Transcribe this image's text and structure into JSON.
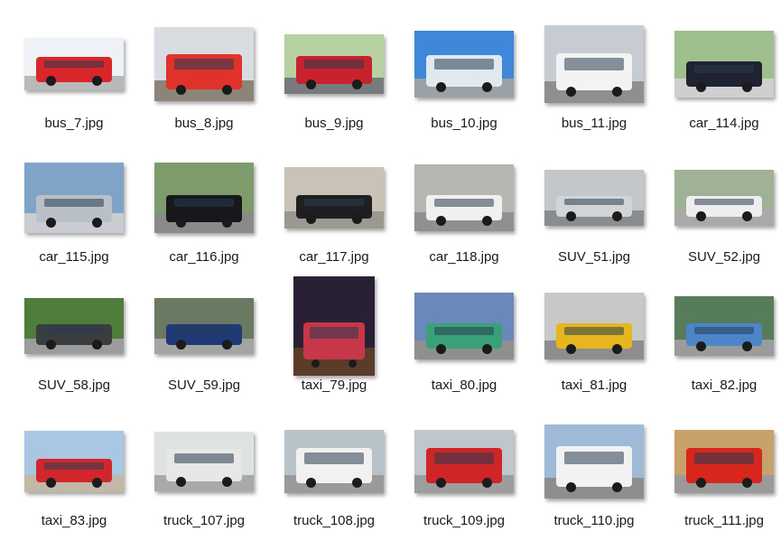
{
  "files": [
    {
      "name": "bus_7.jpg",
      "icon": "bus-icon",
      "sky": "#eef2f6",
      "ground": "#b9b9b9",
      "body": "#d9262b"
    },
    {
      "name": "bus_8.jpg",
      "icon": "bus-icon",
      "sky": "#d9dde2",
      "ground": "#8a8577",
      "body": "#e0312b"
    },
    {
      "name": "bus_9.jpg",
      "icon": "bus-icon",
      "sky": "#b8d1a2",
      "ground": "#777b7e",
      "body": "#c8232d"
    },
    {
      "name": "bus_10.jpg",
      "icon": "bus-icon",
      "sky": "#3f87d8",
      "ground": "#9aa2a8",
      "body": "#dfe9ef"
    },
    {
      "name": "bus_11.jpg",
      "icon": "bus-icon",
      "sky": "#c6ccd2",
      "ground": "#8e8f90",
      "body": "#f3f3f3"
    },
    {
      "name": "car_114.jpg",
      "icon": "car-icon",
      "sky": "#9fbf8f",
      "ground": "#cfcfcf",
      "body": "#1f2230"
    },
    {
      "name": "car_115.jpg",
      "icon": "car-icon",
      "sky": "#7fa4c8",
      "ground": "#c9ccd0",
      "body": "#b9c0c7"
    },
    {
      "name": "car_116.jpg",
      "icon": "car-icon",
      "sky": "#7e9b6b",
      "ground": "#8a8a8a",
      "body": "#16181c"
    },
    {
      "name": "car_117.jpg",
      "icon": "car-icon",
      "sky": "#c9c2b6",
      "ground": "#9a9890",
      "body": "#1f1f22"
    },
    {
      "name": "car_118.jpg",
      "icon": "car-icon",
      "sky": "#b4b7b2",
      "ground": "#909090",
      "body": "#f0f0f0"
    },
    {
      "name": "SUV_51.jpg",
      "icon": "suv-icon",
      "sky": "#c3c7ca",
      "ground": "#8b8c8e",
      "body": "#d2d5d8"
    },
    {
      "name": "SUV_52.jpg",
      "icon": "suv-icon",
      "sky": "#9fb196",
      "ground": "#a9a9a9",
      "body": "#eeeeee"
    },
    {
      "name": "SUV_58.jpg",
      "icon": "suv-icon",
      "sky": "#4f7d3c",
      "ground": "#9c9c9c",
      "body": "#3a3d40"
    },
    {
      "name": "SUV_59.jpg",
      "icon": "suv-icon",
      "sky": "#6a7a62",
      "ground": "#a4a4a4",
      "body": "#1f3a77"
    },
    {
      "name": "taxi_79.jpg",
      "icon": "taxi-icon",
      "sky": "#2a2036",
      "ground": "#5a3c28",
      "body": "#c8364a"
    },
    {
      "name": "taxi_80.jpg",
      "icon": "taxi-icon",
      "sky": "#6a88b9",
      "ground": "#8f8f8f",
      "body": "#3aa07a"
    },
    {
      "name": "taxi_81.jpg",
      "icon": "taxi-icon",
      "sky": "#c7c9c6",
      "ground": "#8d8d8d",
      "body": "#e7b51e"
    },
    {
      "name": "taxi_82.jpg",
      "icon": "taxi-icon",
      "sky": "#567c5a",
      "ground": "#9b9b9b",
      "body": "#4c86c9"
    },
    {
      "name": "taxi_83.jpg",
      "icon": "taxi-icon",
      "sky": "#a9c6e3",
      "ground": "#c2b8a8",
      "body": "#d2262d"
    },
    {
      "name": "truck_107.jpg",
      "icon": "truck-icon",
      "sky": "#dfe2e3",
      "ground": "#a9a9a9",
      "body": "#e7e7e7"
    },
    {
      "name": "truck_108.jpg",
      "icon": "truck-icon",
      "sky": "#b7c3c9",
      "ground": "#9a9a9a",
      "body": "#f1f1f1"
    },
    {
      "name": "truck_109.jpg",
      "icon": "truck-icon",
      "sky": "#bfc7cc",
      "ground": "#9d9d9d",
      "body": "#d12427"
    },
    {
      "name": "truck_110.jpg",
      "icon": "truck-icon",
      "sky": "#9fbad6",
      "ground": "#8e8e8e",
      "body": "#f2f2f2"
    },
    {
      "name": "truck_111.jpg",
      "icon": "truck-icon",
      "sky": "#c8a06a",
      "ground": "#9a9a9a",
      "body": "#d8261d"
    }
  ]
}
